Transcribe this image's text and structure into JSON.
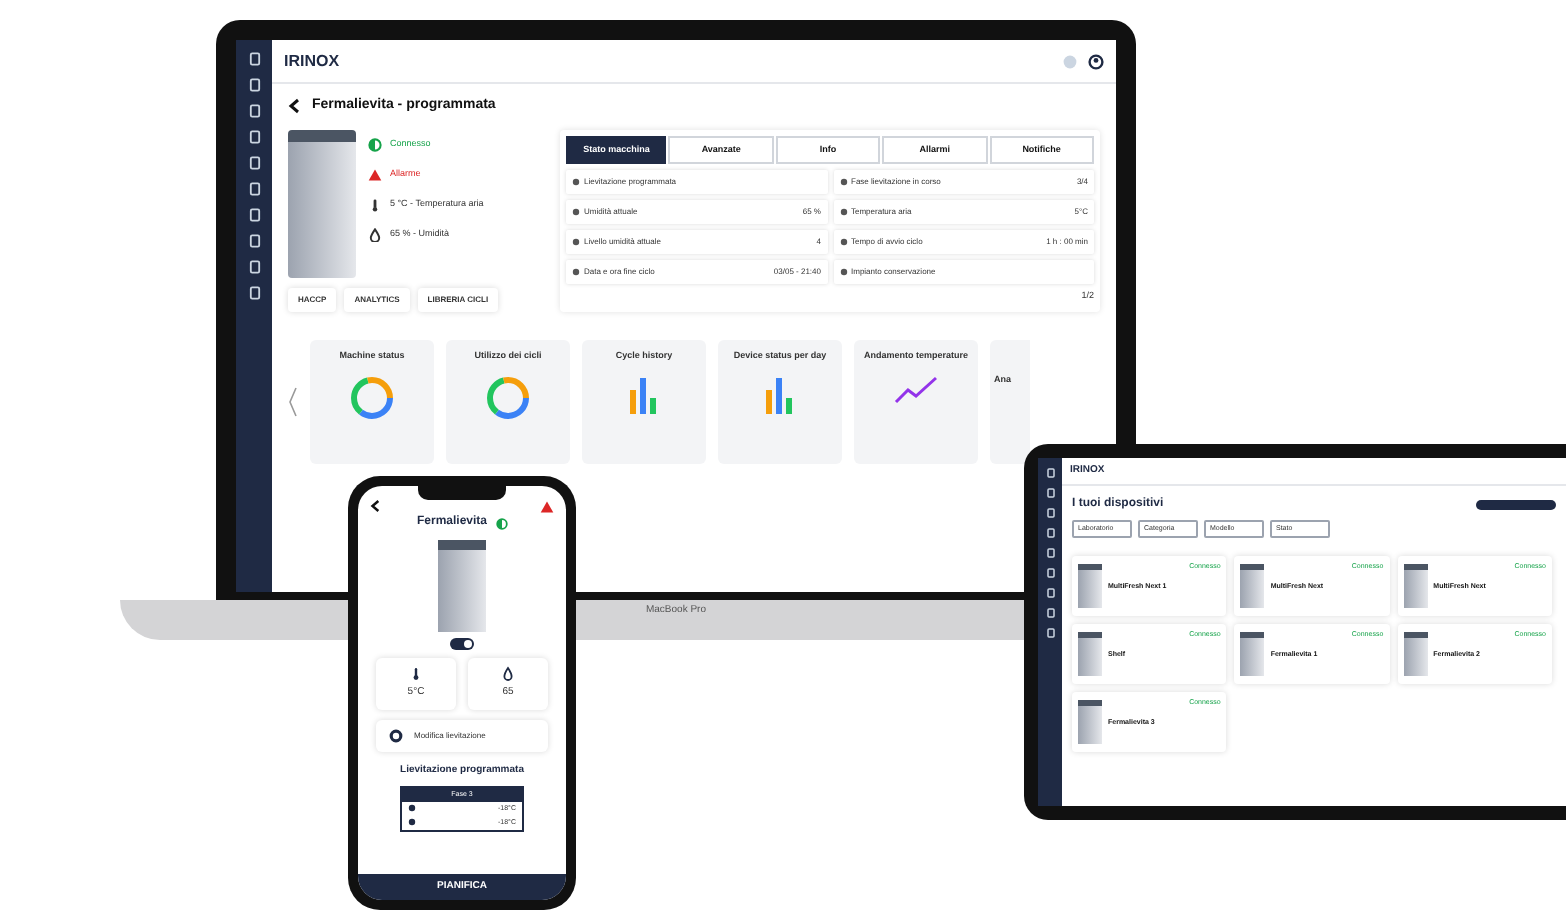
{
  "laptop": {
    "logo": "IRINOX",
    "title": "Fermalievita - programmata",
    "device_label": "MacBook Pro",
    "status": [
      {
        "kind": "connected",
        "text": "Connesso"
      },
      {
        "kind": "alarm",
        "text": "Allarme"
      },
      {
        "kind": "temperature",
        "text": "5 °C - Temperatura aria"
      },
      {
        "kind": "humidity",
        "text": "65 % - Umidità"
      }
    ],
    "buttons": [
      "HACCP",
      "ANALYTICS",
      "LIBRERIA CICLI"
    ],
    "tabs": [
      {
        "label": "Stato macchina",
        "selected": true
      },
      {
        "label": "Avanzate",
        "selected": false
      },
      {
        "label": "Info",
        "selected": false
      },
      {
        "label": "Allarmi",
        "selected": false
      },
      {
        "label": "Notifiche",
        "selected": false
      }
    ],
    "info_rows": [
      {
        "label": "Lievitazione programmata",
        "value": ""
      },
      {
        "label": "Fase lievitazione in corso",
        "value": "3/4"
      },
      {
        "label": "Umidità attuale",
        "value": "65 %"
      },
      {
        "label": "Temperatura aria",
        "value": "5°C"
      },
      {
        "label": "Livello umidità attuale",
        "value": "4"
      },
      {
        "label": "Tempo di avvio ciclo",
        "value": "1 h : 00 min"
      },
      {
        "label": "Data e ora fine ciclo",
        "value": "03/05 - 21:40"
      },
      {
        "label": "Impianto conservazione",
        "value": ""
      }
    ],
    "pagination": "1/2",
    "cards": [
      {
        "title": "Machine status",
        "kind": "donut"
      },
      {
        "title": "Utilizzo dei cicli",
        "kind": "donut"
      },
      {
        "title": "Cycle history",
        "kind": "bars"
      },
      {
        "title": "Device status per day",
        "kind": "bars"
      },
      {
        "title": "Andamento temperature",
        "kind": "line"
      },
      {
        "title": "Ana",
        "kind": "cut"
      }
    ]
  },
  "phone": {
    "title": "Fermalievita",
    "toggle_on": true,
    "temperature": "5°C",
    "humidity": "65",
    "action": "Modifica lievitazione",
    "section_title": "Lievitazione programmata",
    "phase": "Fase 3",
    "rows": [
      "-18°C",
      "-18°C"
    ],
    "bottom_button": "PIANIFICA"
  },
  "tablet": {
    "logo": "IRINOX",
    "title": "I tuoi dispositivi",
    "filters": [
      "Laboratorio",
      "Categoria",
      "Modello",
      "Stato"
    ],
    "devices": [
      {
        "name": "MultiFresh Next 1",
        "status": "Connesso"
      },
      {
        "name": "MultiFresh Next",
        "status": "Connesso"
      },
      {
        "name": "MultiFresh Next",
        "status": "Connesso"
      },
      {
        "name": "Shelf",
        "status": "Connesso"
      },
      {
        "name": "Fermalievita 1",
        "status": "Connesso"
      },
      {
        "name": "Fermalievita 2",
        "status": "Connesso"
      },
      {
        "name": "Fermalievita 3",
        "status": "Connesso"
      }
    ]
  }
}
